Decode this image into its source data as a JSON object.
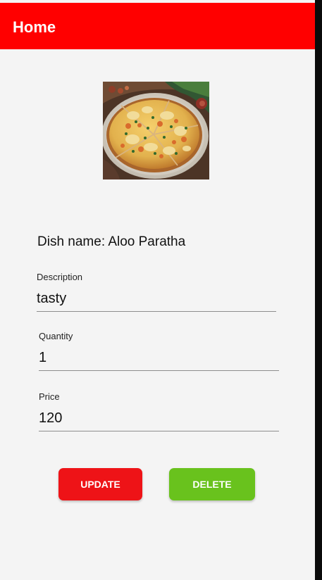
{
  "app_bar": {
    "title": "Home",
    "color": "#ff0000"
  },
  "dish": {
    "image_subject": "pizza",
    "name_label": "Dish name: Aloo Paratha"
  },
  "fields": {
    "description": {
      "label": "Description",
      "value": "tasty"
    },
    "quantity": {
      "label": "Quantity",
      "value": "1"
    },
    "price": {
      "label": "Price",
      "value": "120"
    }
  },
  "buttons": {
    "update": {
      "label": "UPDATE",
      "color": "#ee1317"
    },
    "delete": {
      "label": "DELETE",
      "color": "#69c21d"
    }
  }
}
